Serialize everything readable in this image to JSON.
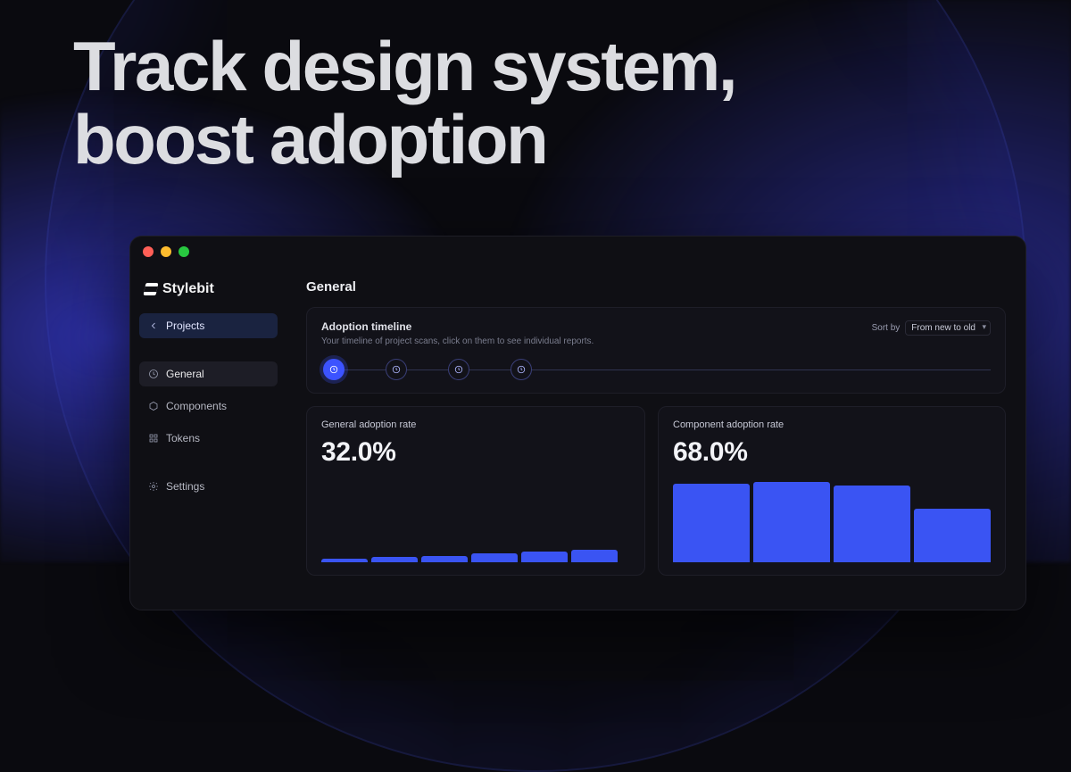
{
  "hero": {
    "line1": "Track design system,",
    "line2": "boost adoption"
  },
  "brand": {
    "name": "Stylebit"
  },
  "sidebar": {
    "projects_label": "Projects",
    "items": [
      {
        "label": "General",
        "icon": "clock",
        "active": true
      },
      {
        "label": "Components",
        "icon": "hexagon",
        "active": false
      },
      {
        "label": "Tokens",
        "icon": "grid",
        "active": false
      }
    ],
    "settings_label": "Settings"
  },
  "page": {
    "title": "General"
  },
  "timeline": {
    "title": "Adoption timeline",
    "subtitle": "Your timeline of project scans, click on them to see individual reports.",
    "sort_label": "Sort by",
    "sort_value": "From new to old",
    "nodes": [
      {
        "active": true
      },
      {
        "active": false
      },
      {
        "active": false
      },
      {
        "active": false
      }
    ]
  },
  "metrics": {
    "general": {
      "title": "General adoption rate",
      "value": "32.0%"
    },
    "component": {
      "title": "Component adoption rate",
      "value": "68.0%"
    }
  },
  "chart_data": [
    {
      "type": "bar",
      "id": "general-adoption",
      "title": "General adoption rate",
      "ylabel": "",
      "values": [
        4,
        6,
        7,
        10,
        12,
        14
      ],
      "note": "values are approximate bar heights; only top edges visible"
    },
    {
      "type": "bar",
      "id": "component-adoption",
      "title": "Component adoption rate",
      "ylabel": "",
      "values": [
        88,
        90,
        86,
        60
      ],
      "note": "values are approximate bar heights in arbitrary units"
    }
  ]
}
